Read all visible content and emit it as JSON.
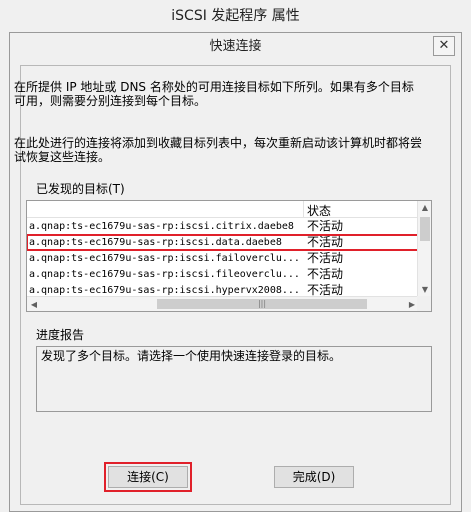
{
  "window": {
    "title": "iSCSI 发起程序 属性"
  },
  "dialog": {
    "title": "快速连接",
    "close_glyph": "✕",
    "description1": "在所提供 IP 地址或 DNS 名称处的可用连接目标如下所列。如果有多个目标可用，则需要分别连接到每个目标。",
    "description2": "在此处进行的连接将添加到收藏目标列表中，每次重新启动该计算机时都将尝试恢复这些连接。",
    "discovered_label": "已发现的目标(T)",
    "list": {
      "status_header": "状态",
      "rows": [
        {
          "target": "a.qnap:ts-ec1679u-sas-rp:iscsi.citrix.daebe8",
          "status": "不活动"
        },
        {
          "target": "a.qnap:ts-ec1679u-sas-rp:iscsi.data.daebe8",
          "status": "不活动"
        },
        {
          "target": "a.qnap:ts-ec1679u-sas-rp:iscsi.failoverclu...",
          "status": "不活动"
        },
        {
          "target": "a.qnap:ts-ec1679u-sas-rp:iscsi.fileoverclu...",
          "status": "不活动"
        },
        {
          "target": "a.qnap:ts-ec1679u-sas-rp:iscsi.hypervx2008...",
          "status": "不活动"
        }
      ],
      "selected_index": 1,
      "scroll_thumb_glyph": "|||"
    },
    "progress_label": "进度报告",
    "progress_text": "发现了多个目标。请选择一个使用快速连接登录的目标。",
    "buttons": {
      "connect": "连接(C)",
      "done": "完成(D)"
    }
  }
}
